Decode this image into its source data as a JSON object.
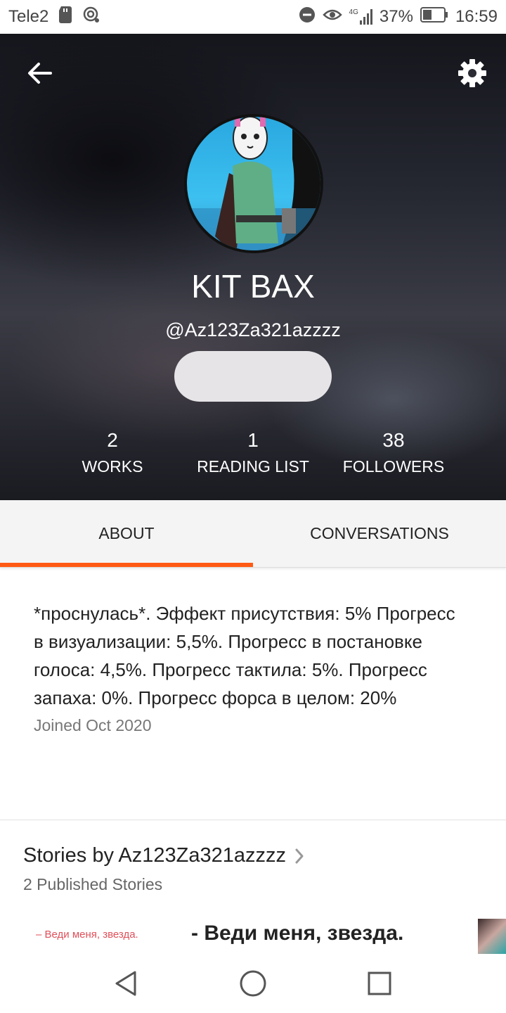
{
  "status_bar": {
    "carrier": "Tele2",
    "network": "4G",
    "battery": "37%",
    "time": "16:59"
  },
  "profile": {
    "name": "KIT BAX",
    "handle": "@Az123Za321azzzz",
    "follow_button_label": "",
    "stats": [
      {
        "value": "2",
        "label": "WORKS"
      },
      {
        "value": "1",
        "label": "READING LIST"
      },
      {
        "value": "38",
        "label": "FOLLOWERS"
      }
    ]
  },
  "tabs": [
    {
      "label": "ABOUT",
      "active": true
    },
    {
      "label": "CONVERSATIONS",
      "active": false
    }
  ],
  "about": {
    "bio": "*проснулась*. Эффект присутствия: 5% Прогресс в визуализации: 5,5%. Прогресс в постановке голоса: 4,5%. Прогресс тактила: 5%. Прогресс запаха: 0%. Прогресс форса в целом: 20%",
    "joined": "Joined Oct 2020"
  },
  "stories": {
    "title": "Stories by Az123Za321azzzz",
    "count": "2 Published Stories",
    "items": [
      {
        "cover_text": "– Веди меня, звезда.",
        "title": "- Веди меня, звезда."
      }
    ]
  },
  "colors": {
    "accent": "#ff5a14",
    "header_bg": "#262832",
    "follow_button": "#e6e4e6"
  }
}
